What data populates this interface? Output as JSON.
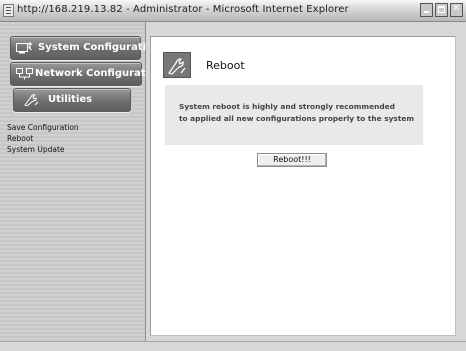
{
  "window": {
    "title": "http://168.219.13.82 - Administrator - Microsoft Internet Explorer",
    "icon": "ie-page-icon"
  },
  "sidebar": {
    "menu": [
      {
        "label": "System Configuration",
        "icon": "monitor-settings-icon"
      },
      {
        "label": "Network Configuration",
        "icon": "network-computers-icon"
      },
      {
        "label": "Utilities",
        "icon": "tools-icon"
      }
    ],
    "submenu": [
      "Save Configuration",
      "Reboot",
      "System Update"
    ]
  },
  "main": {
    "title": "Reboot",
    "icon": "tools-icon",
    "message_line1": "System reboot is highly and strongly recommended",
    "message_line2": "to applied all new configurations properly to the system",
    "button_label": "Reboot!!!"
  },
  "colors": {
    "menu_button": "#6e6e6e",
    "panel_bg": "#ffffff",
    "message_bg": "#e9e9e9"
  }
}
